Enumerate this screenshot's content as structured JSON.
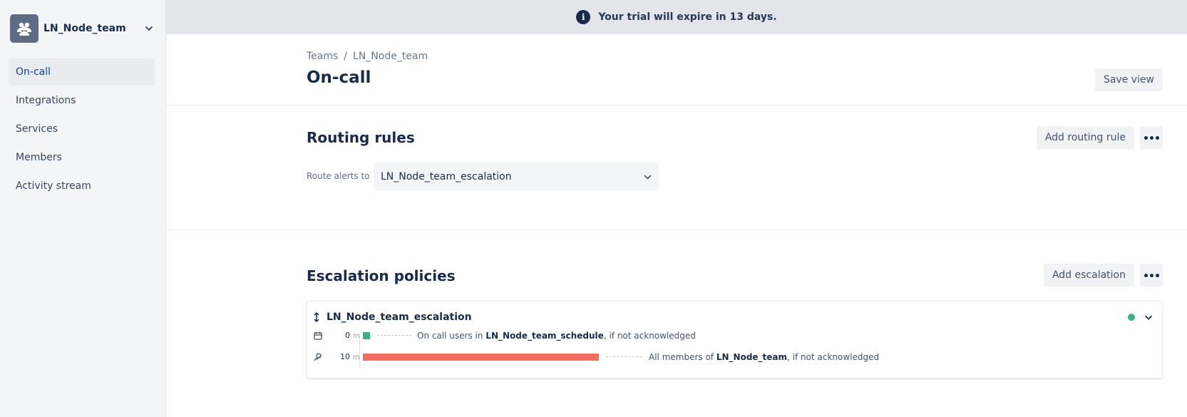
{
  "sidebar": {
    "team_name": "LN_Node_team",
    "items": [
      {
        "label": "On-call",
        "active": true
      },
      {
        "label": "Integrations"
      },
      {
        "label": "Services"
      },
      {
        "label": "Members"
      },
      {
        "label": "Activity stream"
      }
    ]
  },
  "banner": {
    "icon": "i",
    "text": "Your trial will expire in 13 days."
  },
  "header": {
    "breadcrumb": [
      "Teams",
      "/",
      "LN_Node_team"
    ],
    "title": "On-call",
    "save_view_label": "Save view"
  },
  "routing": {
    "title": "Routing rules",
    "add_label": "Add routing rule",
    "route_label": "Route alerts to",
    "route_value": "LN_Node_team_escalation"
  },
  "escalation": {
    "title": "Escalation policies",
    "add_label": "Add escalation",
    "policy": {
      "name": "LN_Node_team_escalation",
      "status": "active",
      "rules": [
        {
          "time": "0",
          "unit": "m",
          "icon": "calendar-icon",
          "bar_color": "#36b37e",
          "text_prefix": "On call users in ",
          "target": "LN_Node_team_schedule",
          "text_suffix": ", if not acknowledged"
        },
        {
          "time": "10",
          "unit": "m",
          "icon": "team-icon",
          "bar_color": "#f06c5c",
          "text_prefix": "All members of ",
          "target": "LN_Node_team",
          "text_suffix": ", if not acknowledged"
        }
      ]
    }
  },
  "colors": {
    "accent": "#0747a6",
    "status_active": "#36b37e",
    "bar_red": "#f06c5c"
  }
}
